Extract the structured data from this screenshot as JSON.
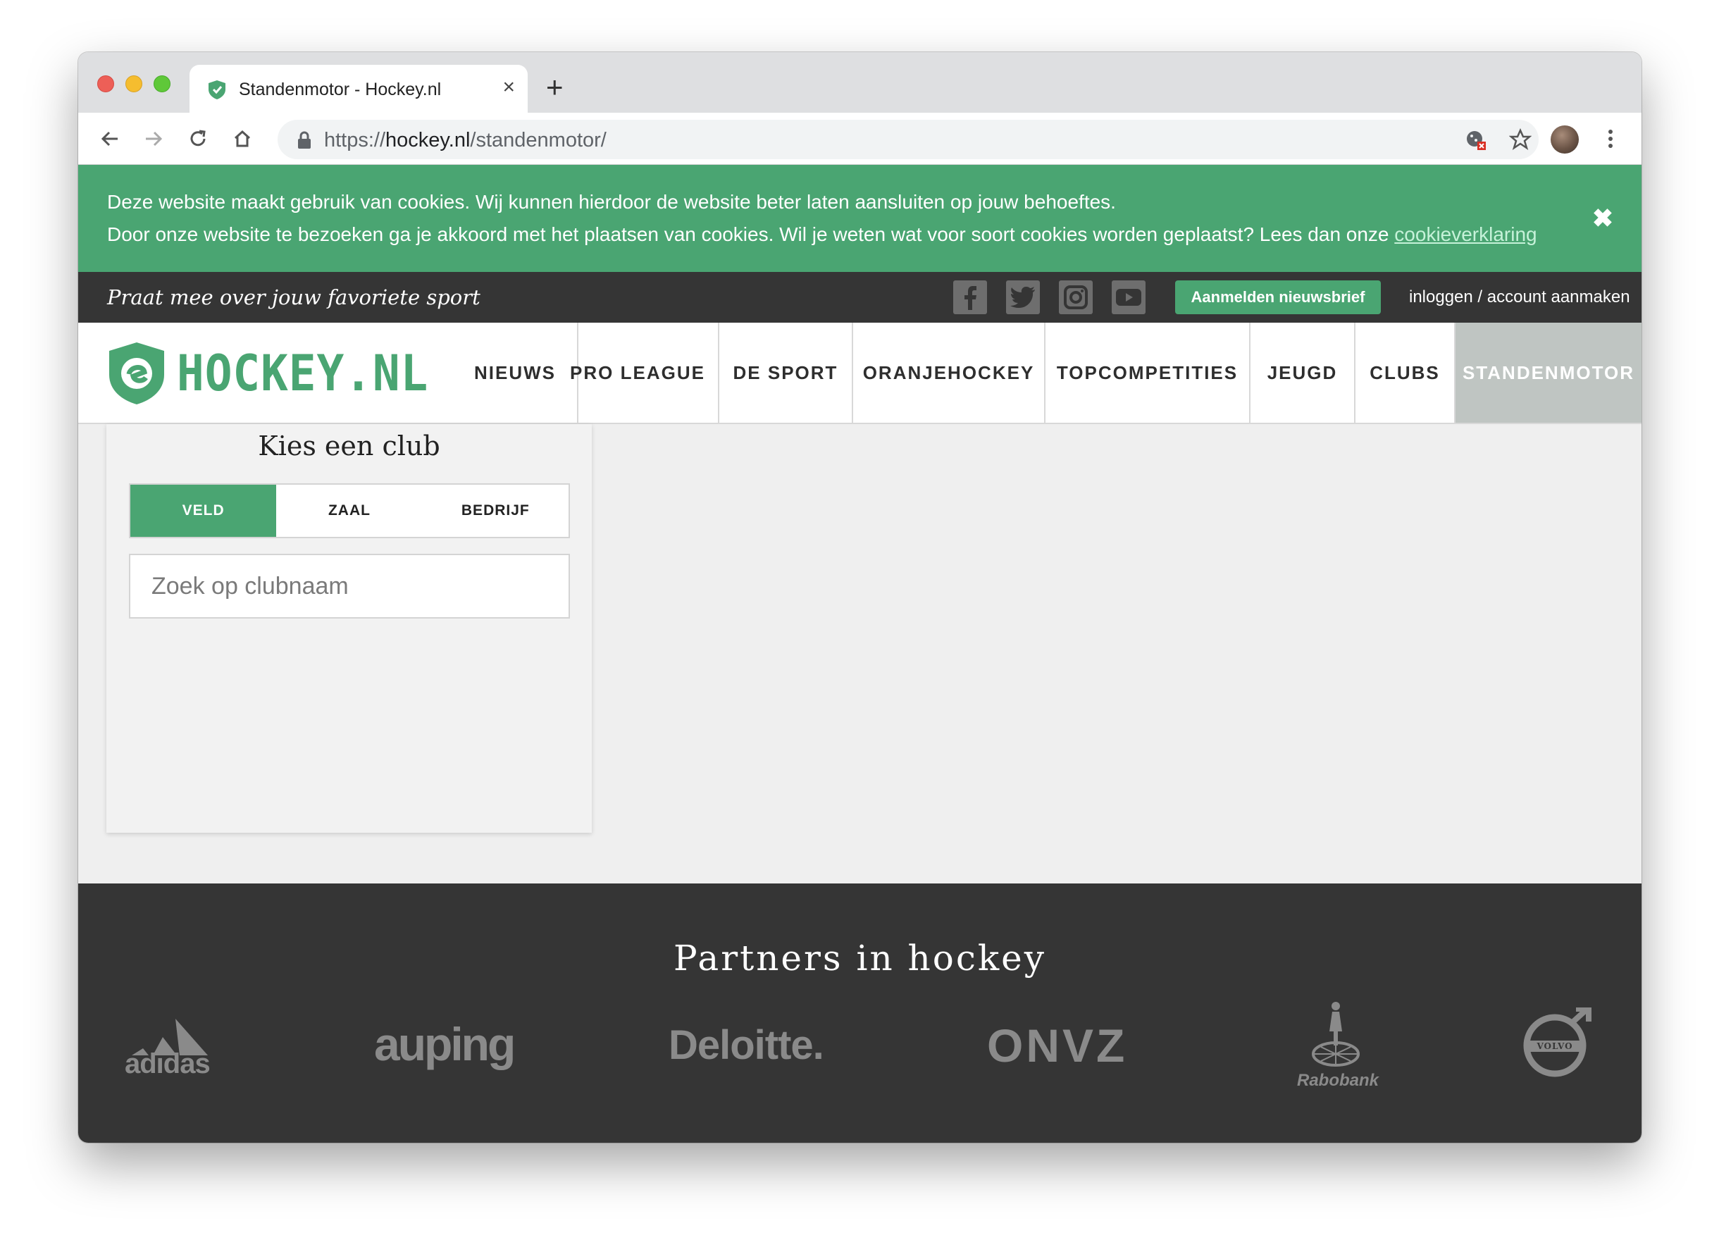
{
  "browser": {
    "tab_title": "Standenmotor - Hockey.nl",
    "url_scheme": "https://",
    "url_host": "hockey.nl",
    "url_path": "/standenmotor/"
  },
  "cookie_banner": {
    "line1": "Deze website maakt gebruik van cookies. Wij kunnen hierdoor de website beter laten aansluiten op jouw behoeftes.",
    "line2": "Door onze website te bezoeken ga je akkoord met het plaatsen van cookies. Wil je weten wat voor soort cookies worden geplaatst? Lees dan onze ",
    "link_text": "cookieverklaring",
    "close_glyph": "✖"
  },
  "topbar": {
    "slogan": "Praat mee over jouw favoriete sport",
    "newsletter_button": "Aanmelden nieuwsbrief",
    "login_link": "inloggen / account aanmaken"
  },
  "logo": {
    "text": "HOCKEY.NL"
  },
  "nav": {
    "items": [
      "NIEUWS",
      "PRO LEAGUE",
      "DE SPORT",
      "ORANJEHOCKEY",
      "TOPCOMPETITIES",
      "JEUGD",
      "CLUBS",
      "STANDENMOTOR"
    ],
    "active": "STANDENMOTOR"
  },
  "club_picker": {
    "title": "Kies een club",
    "tabs": [
      "VELD",
      "ZAAL",
      "BEDRIJF"
    ],
    "active_tab": "VELD",
    "search_placeholder": "Zoek op clubnaam"
  },
  "footer": {
    "title": "Partners in hockey",
    "partners": [
      "adidas",
      "auping",
      "Deloitte.",
      "ONVZ",
      "Rabobank",
      "VOLVO"
    ]
  },
  "colors": {
    "brand_green": "#4aa572",
    "dark_bar": "#353535",
    "active_nav": "#bfc5c2"
  }
}
